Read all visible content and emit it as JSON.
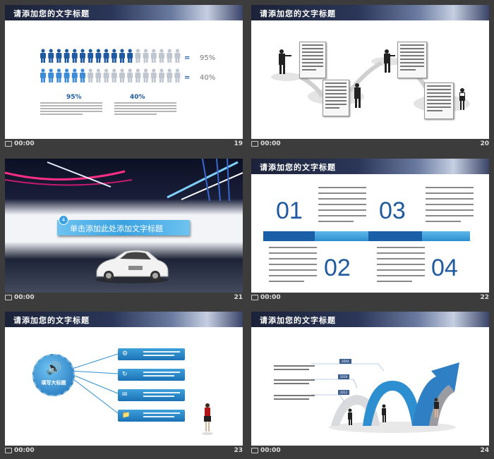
{
  "slides": [
    {
      "title": "请添加您的文字标题",
      "time": "00:00",
      "number": "19",
      "rows": [
        {
          "percent_label": "95%",
          "equals": "="
        },
        {
          "percent_label": "40%",
          "equals": "="
        }
      ],
      "stats": [
        {
          "value": "95%"
        },
        {
          "value": "40%"
        }
      ],
      "fill_levels": [
        0.65,
        0.35
      ],
      "colors": {
        "filled_dark": "#1f5aa0",
        "filled_light": "#3d8ad6",
        "empty": "#bfc6cf"
      }
    },
    {
      "title": "请添加您的文字标题",
      "time": "00:00",
      "number": "20"
    },
    {
      "title": "单击添加此处添加文字标题",
      "badge": "4",
      "time": "00:00",
      "number": "21"
    },
    {
      "title": "请添加您的文字标题",
      "time": "00:00",
      "number": "22",
      "items": [
        {
          "num": "01"
        },
        {
          "num": "02"
        },
        {
          "num": "03"
        },
        {
          "num": "04"
        }
      ]
    },
    {
      "title": "请添加您的文字标题",
      "hub_label": "填写大标题",
      "time": "00:00",
      "number": "23",
      "icons": [
        "gear-icon",
        "refresh-icon",
        "mail-icon",
        "folder-icon"
      ]
    },
    {
      "title": "请添加您的文字标题",
      "time": "00:00",
      "number": "24",
      "years": [
        "20XX",
        "2019",
        "2012"
      ]
    }
  ]
}
